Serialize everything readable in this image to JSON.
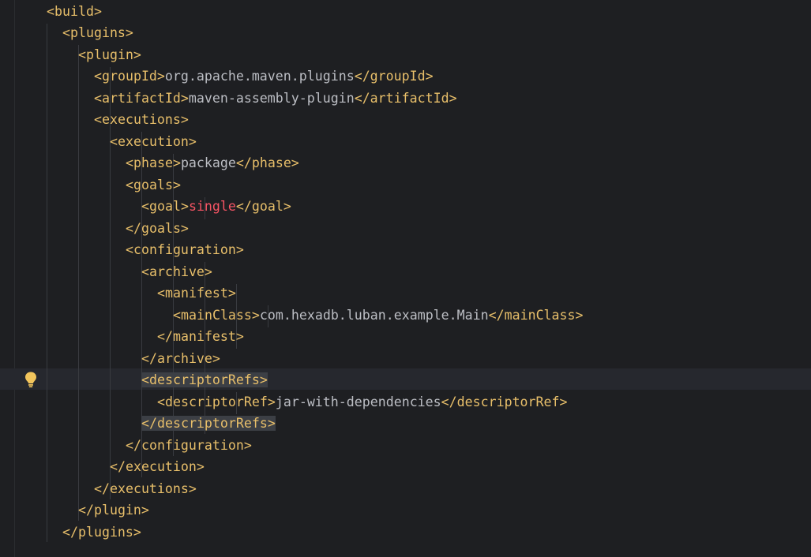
{
  "editor": {
    "lines": [
      {
        "indent": 3,
        "tokens": [
          {
            "t": "tag",
            "v": "<build>"
          }
        ]
      },
      {
        "indent": 5,
        "tokens": [
          {
            "t": "tag",
            "v": "<plugins>"
          }
        ]
      },
      {
        "indent": 7,
        "tokens": [
          {
            "t": "tag",
            "v": "<plugin>"
          }
        ]
      },
      {
        "indent": 9,
        "tokens": [
          {
            "t": "tag",
            "v": "<groupId>"
          },
          {
            "t": "txt",
            "v": "org.apache.maven.plugins"
          },
          {
            "t": "tag",
            "v": "</groupId>"
          }
        ]
      },
      {
        "indent": 9,
        "tokens": [
          {
            "t": "tag",
            "v": "<artifactId>"
          },
          {
            "t": "txt",
            "v": "maven-assembly-plugin"
          },
          {
            "t": "tag",
            "v": "</artifactId>"
          }
        ]
      },
      {
        "indent": 9,
        "tokens": [
          {
            "t": "tag",
            "v": "<executions>"
          }
        ]
      },
      {
        "indent": 11,
        "tokens": [
          {
            "t": "tag",
            "v": "<execution>"
          }
        ]
      },
      {
        "indent": 13,
        "tokens": [
          {
            "t": "tag",
            "v": "<phase>"
          },
          {
            "t": "txt",
            "v": "package"
          },
          {
            "t": "tag",
            "v": "</phase>"
          }
        ]
      },
      {
        "indent": 13,
        "tokens": [
          {
            "t": "tag",
            "v": "<goals>"
          }
        ]
      },
      {
        "indent": 15,
        "tokens": [
          {
            "t": "tag",
            "v": "<goal>"
          },
          {
            "t": "kw",
            "v": "single"
          },
          {
            "t": "tag",
            "v": "</goal>"
          }
        ]
      },
      {
        "indent": 13,
        "tokens": [
          {
            "t": "tag",
            "v": "</goals>"
          }
        ]
      },
      {
        "indent": 13,
        "tokens": [
          {
            "t": "tag",
            "v": "<configuration>"
          }
        ]
      },
      {
        "indent": 15,
        "tokens": [
          {
            "t": "tag",
            "v": "<archive>"
          }
        ]
      },
      {
        "indent": 17,
        "tokens": [
          {
            "t": "tag",
            "v": "<manifest>"
          }
        ]
      },
      {
        "indent": 19,
        "tokens": [
          {
            "t": "tag",
            "v": "<mainClass>"
          },
          {
            "t": "txt",
            "v": "com.hexadb.luban.example.Main"
          },
          {
            "t": "tag",
            "v": "</mainClass>"
          }
        ]
      },
      {
        "indent": 17,
        "tokens": [
          {
            "t": "tag",
            "v": "</manifest>"
          }
        ]
      },
      {
        "indent": 15,
        "tokens": [
          {
            "t": "tag",
            "v": "</archive>"
          }
        ]
      },
      {
        "indent": 15,
        "caret": true,
        "tokens": [
          {
            "t": "tag hl",
            "v": "<descriptorRefs>"
          }
        ]
      },
      {
        "indent": 17,
        "tokens": [
          {
            "t": "tag",
            "v": "<descriptorRef>"
          },
          {
            "t": "txt",
            "v": "jar-with-dependencies"
          },
          {
            "t": "tag",
            "v": "</descriptorRef>"
          }
        ]
      },
      {
        "indent": 15,
        "tokens": [
          {
            "t": "tag hl",
            "v": "</descriptorRefs>"
          }
        ]
      },
      {
        "indent": 13,
        "tokens": [
          {
            "t": "tag",
            "v": "</configuration>"
          }
        ]
      },
      {
        "indent": 11,
        "tokens": [
          {
            "t": "tag",
            "v": "</execution>"
          }
        ]
      },
      {
        "indent": 9,
        "tokens": [
          {
            "t": "tag",
            "v": "</executions>"
          }
        ]
      },
      {
        "indent": 7,
        "tokens": [
          {
            "t": "tag",
            "v": "</plugin>"
          }
        ]
      },
      {
        "indent": 5,
        "tokens": [
          {
            "t": "tag",
            "v": "</plugins>"
          }
        ]
      }
    ],
    "gutter_icon": "lightbulb-icon",
    "colors": {
      "background": "#1e1f22",
      "tag": "#e8bf6a",
      "text": "#bcbec4",
      "keyword": "#f75464",
      "indent_guide": "#393b40",
      "match_highlight": "#3c3f45"
    }
  }
}
